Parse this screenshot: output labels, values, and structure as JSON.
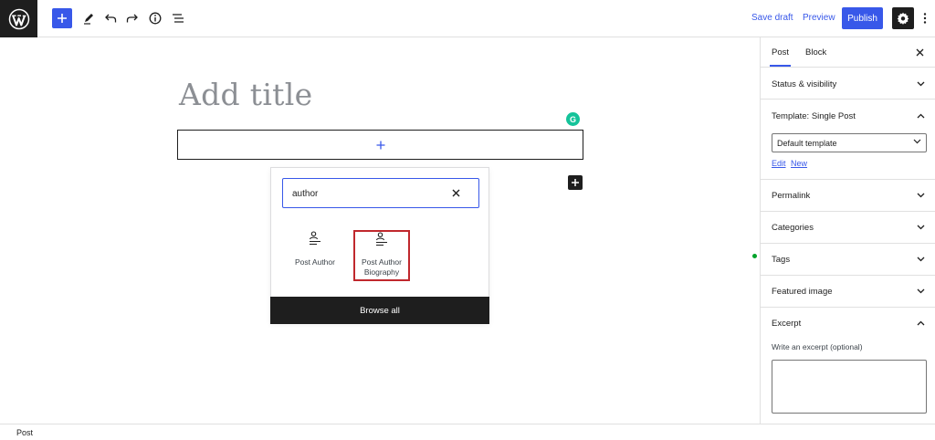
{
  "toolbar": {
    "inserter_icon": "plus-icon",
    "tools_icon": "pencil-icon",
    "undo_icon": "undo-icon",
    "redo_icon": "redo-icon",
    "details_icon": "info-icon",
    "list_view_icon": "list-view-icon",
    "save_draft_label": "Save draft",
    "preview_label": "Preview",
    "publish_label": "Publish",
    "accent_color": "#3858e9"
  },
  "editor": {
    "title_placeholder": "Add title",
    "grammarly_badge": "G"
  },
  "inserter": {
    "search_value": "author",
    "blocks": [
      {
        "label": "Post Author",
        "icon": "post-author-icon",
        "highlighted": false
      },
      {
        "label": "Post Author Biography",
        "icon": "post-author-biography-icon",
        "highlighted": true
      }
    ],
    "browse_all_label": "Browse all"
  },
  "sidebar": {
    "tabs": [
      {
        "label": "Post",
        "active": true
      },
      {
        "label": "Block",
        "active": false
      }
    ],
    "panels": {
      "status": "Status & visibility",
      "template": "Template: Single Post",
      "permalink": "Permalink",
      "categories": "Categories",
      "tags": "Tags",
      "featured_image": "Featured image",
      "excerpt": "Excerpt"
    },
    "template_select_value": "Default template",
    "template_edit_link": "Edit",
    "template_new_link": "New",
    "excerpt_label": "Write an excerpt (optional)"
  },
  "footer": {
    "breadcrumb": "Post"
  }
}
